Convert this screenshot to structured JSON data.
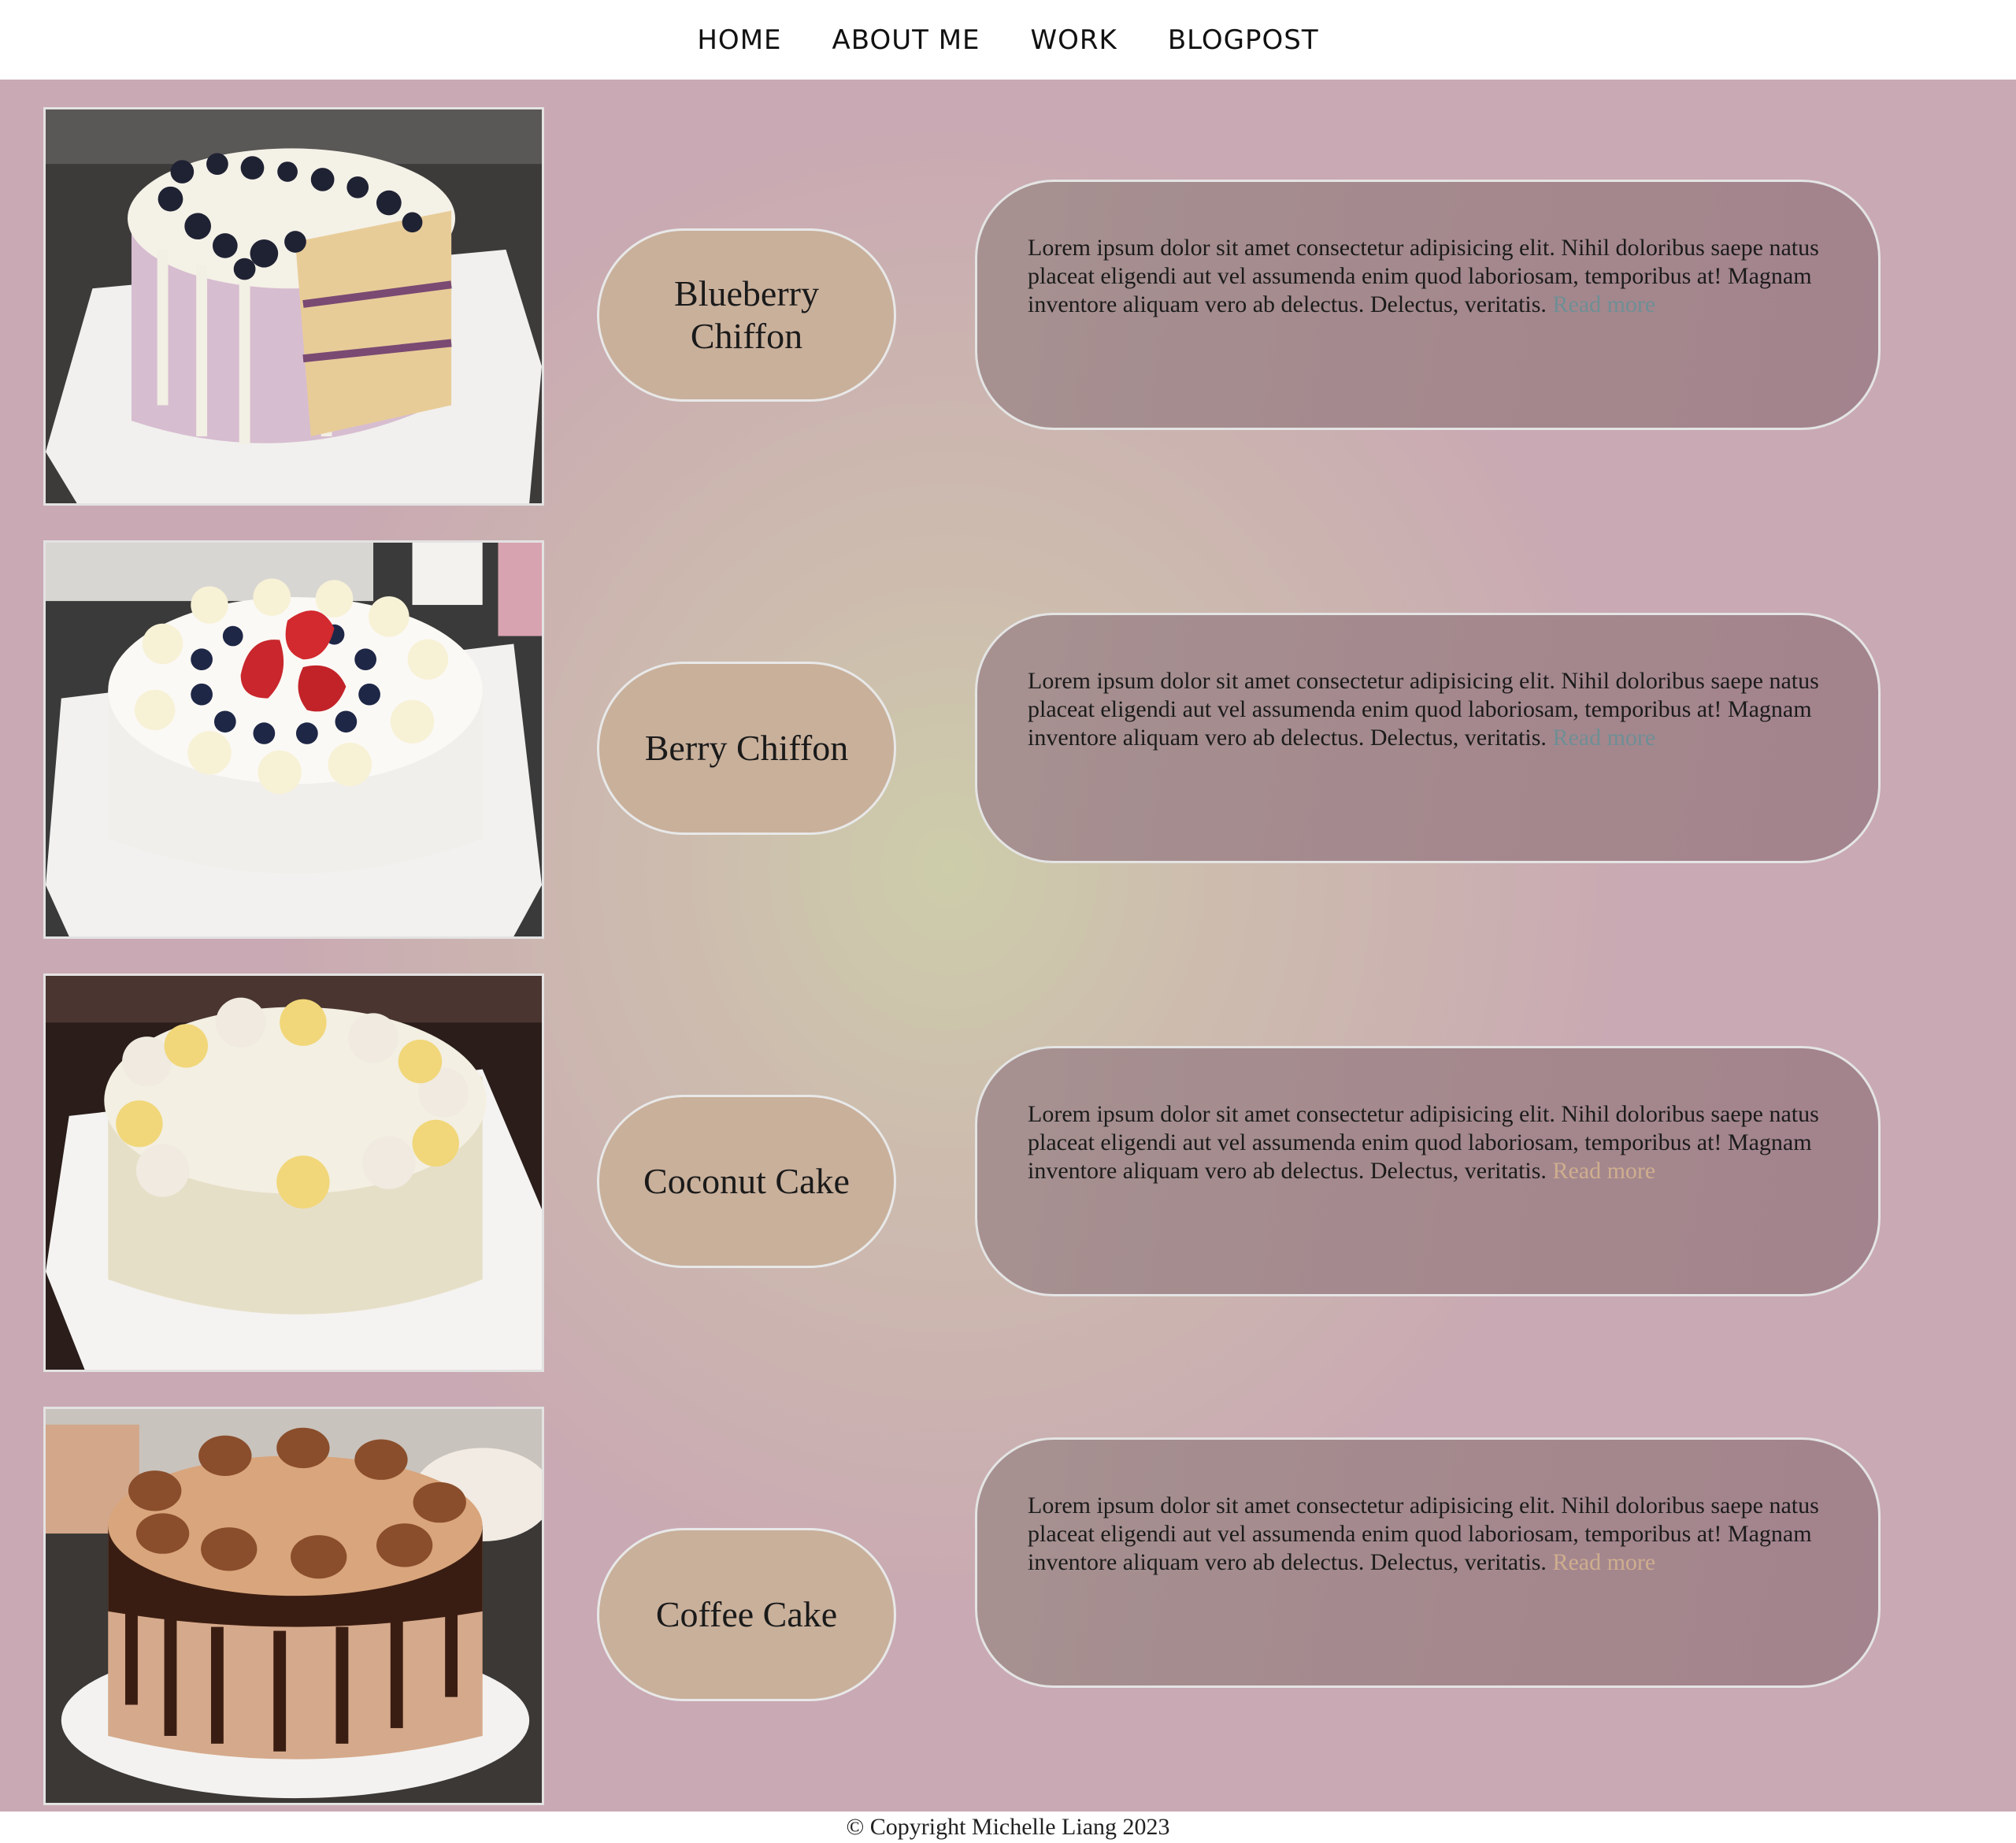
{
  "nav": {
    "items": [
      {
        "label": "HOME"
      },
      {
        "label": "ABOUT ME"
      },
      {
        "label": "WORK"
      },
      {
        "label": "BLOGPOST"
      }
    ]
  },
  "cakes": [
    {
      "title": "Blueberry Chiffon",
      "description": "Lorem ipsum dolor sit amet consectetur adipisicing elit. Nihil doloribus saepe natus placeat eligendi aut vel assumenda enim quod laboriosam, temporibus at! Magnam inventore aliquam vero ab delectus. Delectus, veritatis.",
      "link": "Read more",
      "link_color": "#6e8f95"
    },
    {
      "title": "Berry Chiffon",
      "description": "Lorem ipsum dolor sit amet consectetur adipisicing elit. Nihil doloribus saepe natus placeat eligendi aut vel assumenda enim quod laboriosam, temporibus at! Magnam inventore aliquam vero ab delectus. Delectus, veritatis.",
      "link": "Read more",
      "link_color": "#6e8f95"
    },
    {
      "title": "Coconut Cake",
      "description": "Lorem ipsum dolor sit amet consectetur adipisicing elit. Nihil doloribus saepe natus placeat eligendi aut vel assumenda enim quod laboriosam, temporibus at! Magnam inventore aliquam vero ab delectus. Delectus, veritatis.",
      "link": "Read more",
      "link_color": "#cfae8e"
    },
    {
      "title": "Coffee Cake",
      "description": "Lorem ipsum dolor sit amet consectetur adipisicing elit. Nihil doloribus saepe natus placeat eligendi aut vel assumenda enim quod laboriosam, temporibus at! Magnam inventore aliquam vero ab delectus. Delectus, veritatis.",
      "link": "Read more",
      "link_color": "#cfae8e"
    }
  ],
  "footer": {
    "text": "© Copyright Michelle Liang 2023"
  },
  "colors": {
    "title_pill": "#c9b09b",
    "description_pill": "#a4888d",
    "page_background": "#c9a9b3"
  }
}
